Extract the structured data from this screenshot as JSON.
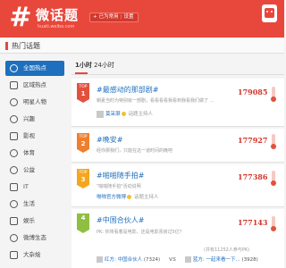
{
  "header": {
    "logo_text": "微话题",
    "logo_url": "huati.weibo.com",
    "fav_label": "已为常用",
    "fav_sep": "|",
    "fav_setting": "设置"
  },
  "page_title": "热门话题",
  "sidebar": {
    "items": [
      {
        "label": "全国热点",
        "icon": "location-icon",
        "active": true
      },
      {
        "label": "区域热点",
        "icon": "map-icon",
        "active": false
      },
      {
        "label": "明星人物",
        "icon": "person-icon",
        "active": false
      },
      {
        "label": "兴趣",
        "icon": "heart-icon",
        "active": false
      },
      {
        "label": "影视",
        "icon": "tv-icon",
        "active": false
      },
      {
        "label": "体育",
        "icon": "ball-icon",
        "active": false
      },
      {
        "label": "公益",
        "icon": "charity-icon",
        "active": false
      },
      {
        "label": "IT",
        "icon": "monitor-icon",
        "active": false
      },
      {
        "label": "生活",
        "icon": "life-icon",
        "active": false
      },
      {
        "label": "娱乐",
        "icon": "music-icon",
        "active": false
      },
      {
        "label": "微博生态",
        "icon": "weibo-icon",
        "active": false
      },
      {
        "label": "大杂烩",
        "icon": "grid-icon",
        "active": false
      }
    ]
  },
  "tabs": [
    {
      "label": "1小时",
      "active": true
    },
    {
      "label": "24小时",
      "active": false
    }
  ],
  "topics": [
    {
      "badge": "TOP",
      "rank": "1",
      "title": "#最感动的那部剧#",
      "desc": "朝夏当时为特别就一部剧，看看看看我看到我看我们做了 …",
      "owner_name": "莫采灏",
      "owner_role": "话题主持人",
      "count": "179085"
    },
    {
      "badge": "TOP",
      "rank": "2",
      "title": "#晚安#",
      "desc": "经你那我们，只能在这一道时间的晚吧",
      "count": "177927"
    },
    {
      "badge": "TOP",
      "rank": "3",
      "title": "#啪啪随手拍#",
      "desc": "\"啪啪随手拍\"活动说明",
      "owner_name": "啪啪官方微博",
      "owner_role": "话题主持人",
      "count": "177386"
    },
    {
      "badge": "",
      "rank": "4",
      "title": "#中国合伙人#",
      "desc": "PK: 你将看着是电影，还是电影票房过5亿？",
      "extra": "(共有11252人参与PK)",
      "vs_left_name": "红方: 中国合伙人",
      "vs_left_count": "(7324)",
      "vs_label": "VS",
      "vs_right_name": "蓝方: 一起来看一下...",
      "vs_right_count": "(3928)",
      "count": "177143"
    }
  ],
  "colors": {
    "brand": "#e8483b",
    "active_blue": "#1e6fbd",
    "count_red": "#d2342a"
  }
}
